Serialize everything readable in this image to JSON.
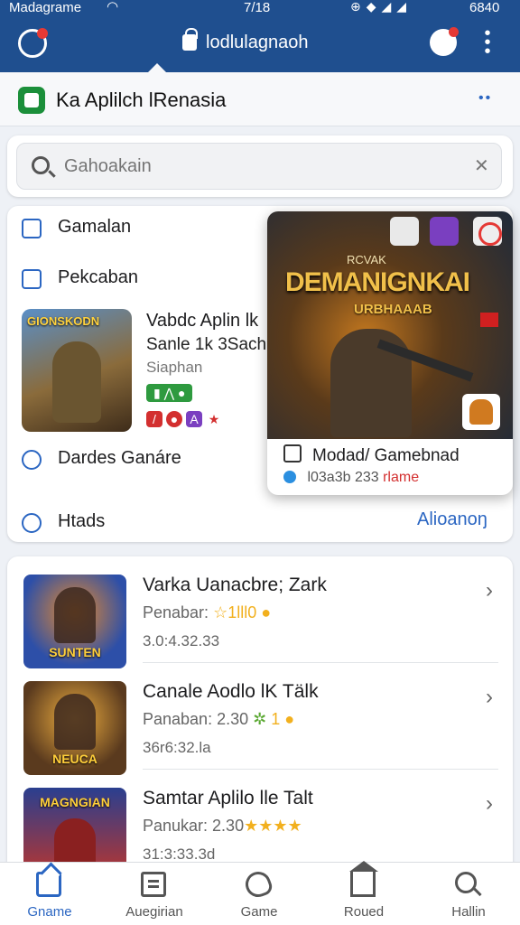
{
  "status_bar": {
    "carrier": "Madagrame",
    "time": "7/18",
    "battery": "6840"
  },
  "app_bar": {
    "url": "lodlulagnaoh"
  },
  "title_bar": {
    "title": "Ka Aplilch lRenasia"
  },
  "search": {
    "placeholder": "Gahoakain"
  },
  "menu": {
    "item1": "Gamalan",
    "item2": "Pekcaban",
    "item3": "Dardes Ganáre",
    "item4": "Htads",
    "see_all": "Alioanoŋ"
  },
  "featured": {
    "thumb_title": "GIONSKODN",
    "name": "Vabdc Aplin lk",
    "subtitle": "Sanle 1k 3Sach",
    "genre": "Siaphan"
  },
  "popup": {
    "art_subtitle": "RCVAK",
    "art_title": "DEMANIGNKAI",
    "art_title2": "URBHAAAB",
    "title": "Modad/ Gamebnad",
    "meta_num": "l03a3b 233",
    "meta_red": "rlame"
  },
  "list": [
    {
      "name": "Varka Uanacbre; Zark",
      "meta_prefix": "Penabar: ",
      "meta_value": "☆1lll0",
      "date": "3.0:4.32.33",
      "thumb_label": "SUNTEN",
      "thumb_bg": "#2d4fa8"
    },
    {
      "name": "Canale Aodlo lK Tälk",
      "meta_prefix": "Panaban: ",
      "meta_value": "2.30",
      "meta_extra": "1",
      "date": "36r6:32.la",
      "thumb_label": "NEUCA",
      "thumb_bg": "#5a3a1e"
    },
    {
      "name": "Samtar Aplilo lle Talt",
      "meta_prefix": "Panukar: ",
      "meta_value": "2.30",
      "meta_stars": "★★★★",
      "date": "31:3:33.3d",
      "thumb_label": "MAGNGIAN",
      "thumb_bg": "#2a3f8f"
    }
  ],
  "bottom_nav": [
    {
      "label": "Gname",
      "icon": "home-icon",
      "active": true
    },
    {
      "label": "Auegirian",
      "icon": "list-icon",
      "active": false
    },
    {
      "label": "Game",
      "icon": "game-icon",
      "active": false
    },
    {
      "label": "Roued",
      "icon": "bank-icon",
      "active": false
    },
    {
      "label": "Hallin",
      "icon": "search-icon",
      "active": false
    }
  ]
}
